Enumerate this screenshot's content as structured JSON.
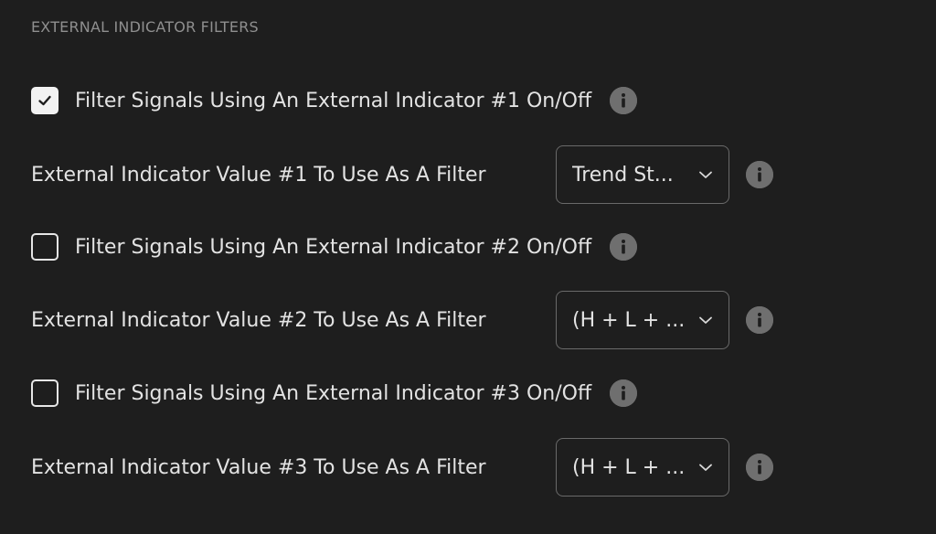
{
  "section": {
    "title": "EXTERNAL INDICATOR FILTERS"
  },
  "colors": {
    "background": "#1e1e1e",
    "text": "#e3e3e3",
    "muted_text": "#8f8f8f",
    "info_icon": "#6f6f6f",
    "checkbox_checked_fill": "#f2f2f2"
  },
  "filters": [
    {
      "toggle_label": "Filter Signals Using An External Indicator #1 On/Off",
      "checked": true,
      "value_label": "External Indicator Value #1 To Use As A Filter",
      "value_selected": "Trend St..."
    },
    {
      "toggle_label": "Filter Signals Using An External Indicator #2 On/Off",
      "checked": false,
      "value_label": "External Indicator Value #2 To Use As A Filter",
      "value_selected": "(H + L + ..."
    },
    {
      "toggle_label": "Filter Signals Using An External Indicator #3 On/Off",
      "checked": false,
      "value_label": "External Indicator Value #3 To Use As A Filter",
      "value_selected": "(H + L + ..."
    }
  ],
  "icons": {
    "info": "info-icon",
    "check": "check-icon",
    "dropdown": "chevron-down-icon"
  }
}
